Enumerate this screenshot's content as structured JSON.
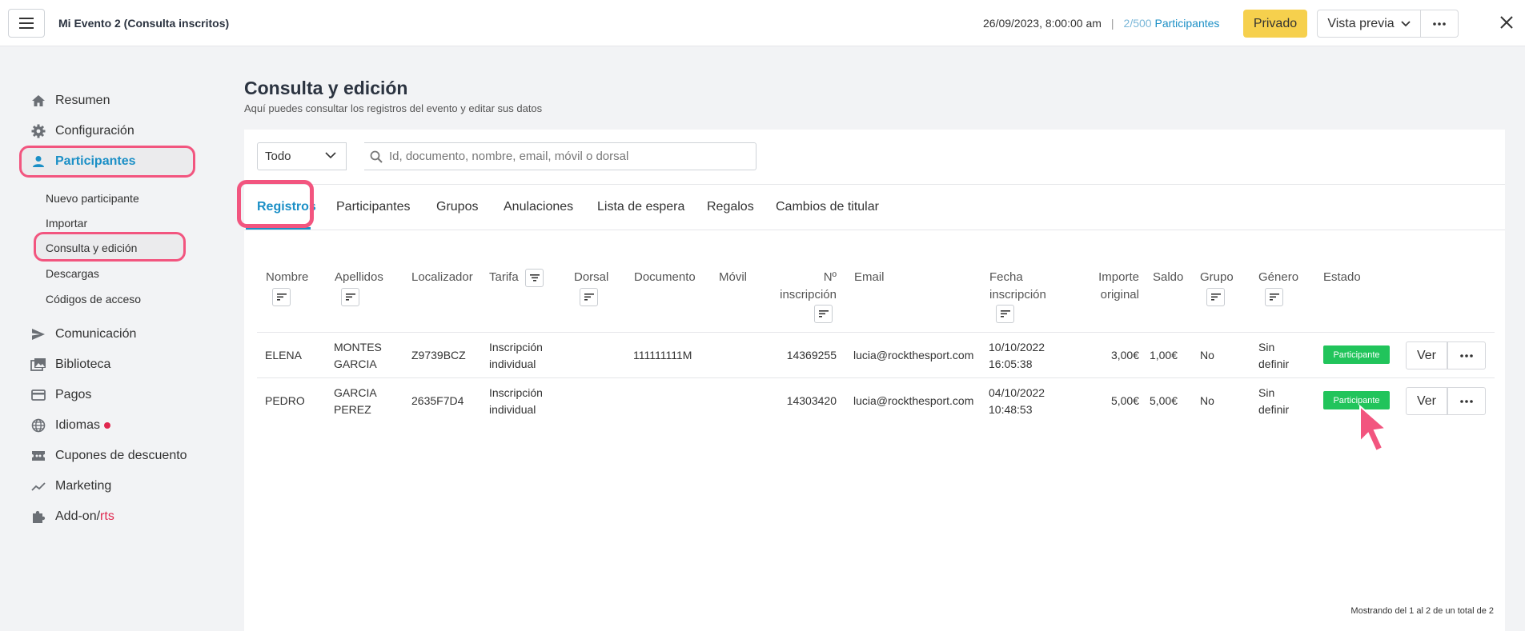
{
  "topbar": {
    "event_title": "Mi Evento 2 (Consulta inscritos)",
    "datetime": "26/09/2023, 8:00:00 am",
    "separator": "|",
    "participants_count": "2/500",
    "participants_label": "Participantes",
    "private_label": "Privado",
    "preview_label": "Vista previa"
  },
  "sidebar": {
    "items": [
      {
        "label": "Resumen",
        "icon": "home-icon"
      },
      {
        "label": "Configuración",
        "icon": "gear-icon"
      },
      {
        "label": "Participantes",
        "icon": "person-icon"
      },
      {
        "label": "Comunicación",
        "icon": "send-icon"
      },
      {
        "label": "Biblioteca",
        "icon": "images-icon"
      },
      {
        "label": "Pagos",
        "icon": "card-icon"
      },
      {
        "label": "Idiomas",
        "icon": "globe-icon"
      },
      {
        "label": "Cupones de descuento",
        "icon": "ticket-icon"
      },
      {
        "label": "Marketing",
        "icon": "trend-icon"
      },
      {
        "label_main": "Add-on/",
        "label_accent": "rts",
        "icon": "puzzle-icon"
      }
    ],
    "subitems": [
      "Nuevo participante",
      "Importar",
      "Consulta y edición",
      "Descargas",
      "Códigos de acceso"
    ]
  },
  "page": {
    "title": "Consulta y edición",
    "subtitle": "Aquí puedes consultar los registros del evento y editar sus datos"
  },
  "filter": {
    "select_value": "Todo",
    "search_placeholder": "Id, documento, nombre, email, móvil o dorsal"
  },
  "tabs": [
    "Registros",
    "Participantes",
    "Grupos",
    "Anulaciones",
    "Lista de espera",
    "Regalos",
    "Cambios de titular"
  ],
  "table": {
    "headers": {
      "nombre": "Nombre",
      "apellidos": "Apellidos",
      "localizador": "Localizador",
      "tarifa": "Tarifa",
      "dorsal": "Dorsal",
      "documento": "Documento",
      "movil": "Móvil",
      "n_inscripcion_1": "Nº",
      "n_inscripcion_2": "inscripción",
      "email": "Email",
      "fecha_1": "Fecha",
      "fecha_2": "inscripción",
      "importe_1": "Importe",
      "importe_2": "original",
      "saldo": "Saldo",
      "grupo": "Grupo",
      "genero": "Género",
      "estado": "Estado"
    },
    "rows": [
      {
        "nombre": "ELENA",
        "apellidos_1": "MONTES",
        "apellidos_2": "GARCIA",
        "localizador": "Z9739BCZ",
        "tarifa_1": "Inscripción",
        "tarifa_2": "individual",
        "documento": "111111111M",
        "n_inscripcion": "14369255",
        "email": "lucia@rockthesport.com",
        "fecha_1": "10/10/2022",
        "fecha_2": "16:05:38",
        "importe": "3,00€",
        "saldo": "1,00€",
        "grupo": "No",
        "genero_1": "Sin",
        "genero_2": "definir",
        "estado": "Participante",
        "ver": "Ver"
      },
      {
        "nombre": "PEDRO",
        "apellidos_1": "GARCIA",
        "apellidos_2": "PEREZ",
        "localizador": "2635F7D4",
        "tarifa_1": "Inscripción",
        "tarifa_2": "individual",
        "documento": "",
        "n_inscripcion": "14303420",
        "email": "lucia@rockthesport.com",
        "fecha_1": "04/10/2022",
        "fecha_2": "10:48:53",
        "importe": "5,00€",
        "saldo": "5,00€",
        "grupo": "No",
        "genero_1": "Sin",
        "genero_2": "definir",
        "estado": "Participante",
        "ver": "Ver"
      }
    ],
    "footer": "Mostrando del 1 al 2 de un total de 2"
  },
  "colors": {
    "accent": "#1b8fc6",
    "highlight": "#f2557f",
    "badge": "#21c45b",
    "private_button": "#f6d04d"
  }
}
